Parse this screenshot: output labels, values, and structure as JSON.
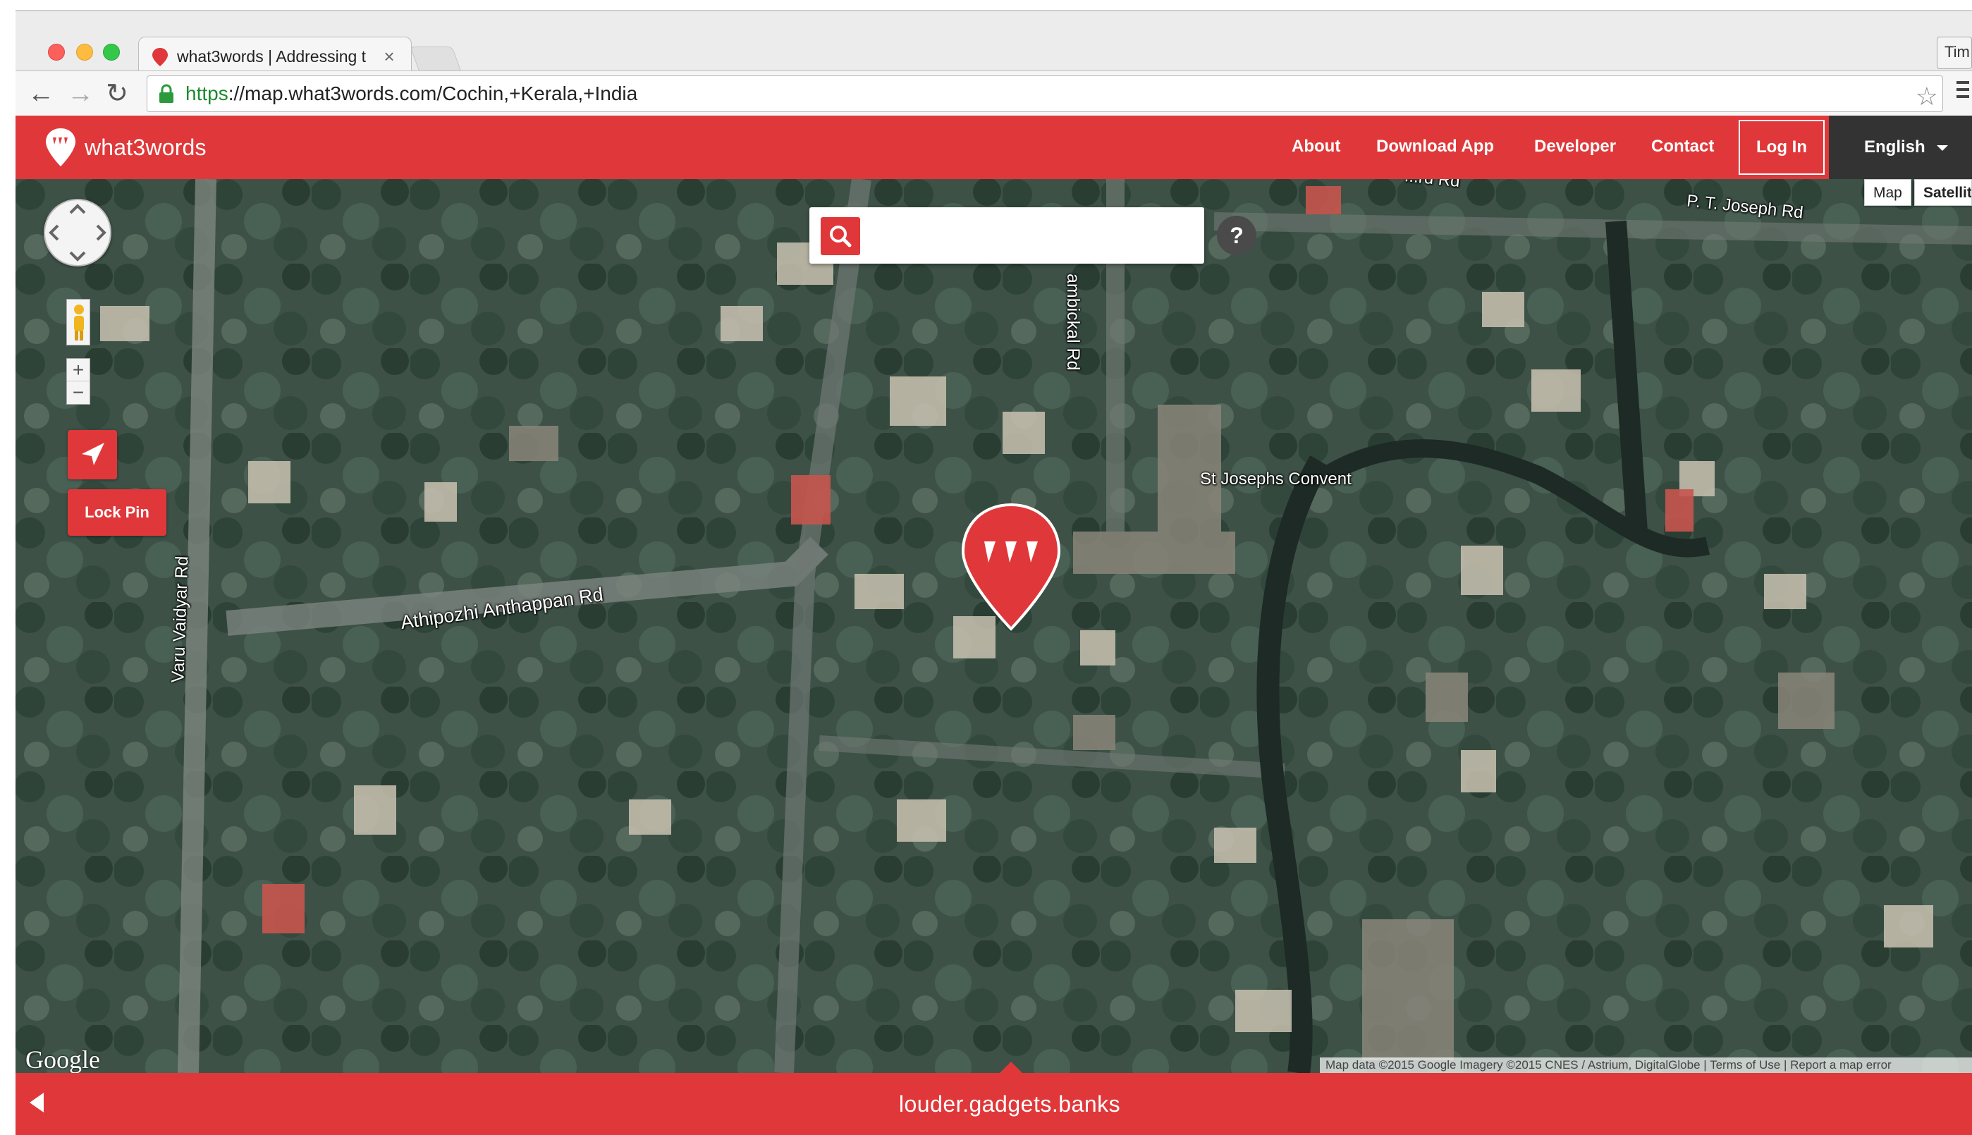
{
  "browser": {
    "tab_title": "what3words | Addressing t",
    "tab_close": "×",
    "profile_label": "Tim",
    "url_scheme": "https",
    "url_rest": "://map.what3words.com/Cochin,+Kerala,+India"
  },
  "header": {
    "logo_text": "what3words",
    "nav": [
      "About",
      "Download App",
      "Developer",
      "Contact"
    ],
    "login_label": "Log In",
    "language_label": "English"
  },
  "map": {
    "type_map": "Map",
    "type_satellite": "Satellite",
    "labels": {
      "joseph_rd": "P. T. Joseph Rd",
      "convent": "St Josephs Convent",
      "anthappan_rd": "Athipozhi Anthappan Rd",
      "vaidyar_rd": "Varu Vaidyar Rd",
      "bickal_rd": "ambickal Rd",
      "top_rd": "...rd Rd"
    },
    "lock_pin_label": "Lock Pin",
    "help_label": "?",
    "google_logo": "Google",
    "attribution": "Map data ©2015 Google Imagery ©2015 CNES / Astrium, DigitalGlobe | Terms of Use | Report a map error"
  },
  "footer": {
    "three_words": "louder.gadgets.banks"
  },
  "colors": {
    "brand_red": "#e0383a",
    "header_dark": "#333333"
  }
}
